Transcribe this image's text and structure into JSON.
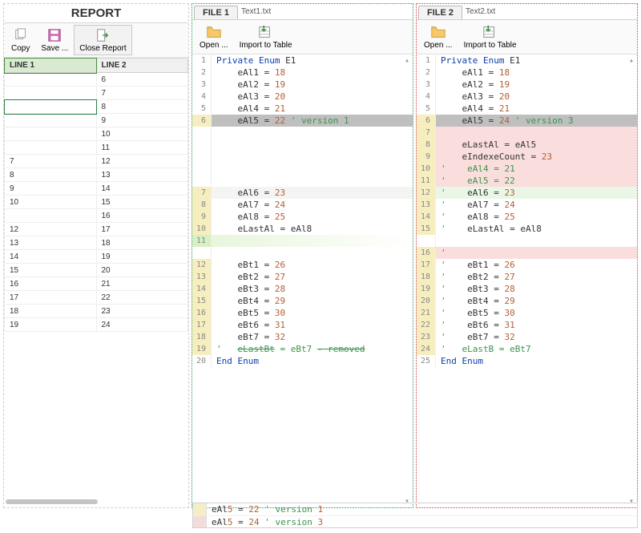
{
  "report": {
    "title": "REPORT",
    "toolbar": {
      "copy": "Copy",
      "save": "Save ...",
      "close": "Close Report"
    },
    "headers": {
      "col1": "LINE 1",
      "col2": "LINE 2"
    },
    "rows": [
      {
        "l1": "",
        "l2": "6"
      },
      {
        "l1": "",
        "l2": "7"
      },
      {
        "l1": "",
        "l2": "8"
      },
      {
        "l1": "",
        "l2": "9"
      },
      {
        "l1": "",
        "l2": "10"
      },
      {
        "l1": "",
        "l2": "11"
      },
      {
        "l1": "7",
        "l2": "12"
      },
      {
        "l1": "8",
        "l2": "13"
      },
      {
        "l1": "9",
        "l2": "14"
      },
      {
        "l1": "10",
        "l2": "15"
      },
      {
        "l1": "",
        "l2": "16"
      },
      {
        "l1": "12",
        "l2": "17"
      },
      {
        "l1": "13",
        "l2": "18"
      },
      {
        "l1": "14",
        "l2": "19"
      },
      {
        "l1": "15",
        "l2": "20"
      },
      {
        "l1": "16",
        "l2": "21"
      },
      {
        "l1": "17",
        "l2": "22"
      },
      {
        "l1": "18",
        "l2": "23"
      },
      {
        "l1": "19",
        "l2": "24"
      }
    ],
    "selected_row": 2
  },
  "file1": {
    "tab": "FILE 1",
    "name": "Text1.txt",
    "toolbar": {
      "open": "Open ...",
      "import": "Import to Table"
    },
    "lines": [
      {
        "n": 1,
        "gut": "",
        "cls": "",
        "html": "<span class=\"tok-kw\">Private Enum</span> E1"
      },
      {
        "n": 2,
        "gut": "",
        "cls": "",
        "html": "    eAl1 = <span class=\"tok-num\">18</span>"
      },
      {
        "n": 3,
        "gut": "",
        "cls": "",
        "html": "    eAl2 = <span class=\"tok-num\">19</span>"
      },
      {
        "n": 4,
        "gut": "",
        "cls": "",
        "html": "    eAl3 = <span class=\"tok-num\">20</span>"
      },
      {
        "n": 5,
        "gut": "",
        "cls": "",
        "html": "    eAl4 = <span class=\"tok-num\">21</span>"
      },
      {
        "n": 6,
        "gut": "mark-yellow",
        "cls": "line-diff-grey",
        "html": "    eAl5 = <span class=\"tok-num\">22</span> <span class=\"tok-cm\">' version 1</span>"
      },
      {
        "n": "",
        "gut": "",
        "cls": "",
        "html": ""
      },
      {
        "n": "",
        "gut": "",
        "cls": "",
        "html": ""
      },
      {
        "n": "",
        "gut": "",
        "cls": "",
        "html": ""
      },
      {
        "n": "",
        "gut": "",
        "cls": "",
        "html": ""
      },
      {
        "n": "",
        "gut": "",
        "cls": "",
        "html": ""
      },
      {
        "n": 7,
        "gut": "mark-yellow",
        "cls": "line-diff-greysoft",
        "html": "    eAl6 = <span class=\"tok-num\">23</span>"
      },
      {
        "n": 8,
        "gut": "mark-yellow",
        "cls": "",
        "html": "    eAl7 = <span class=\"tok-num\">24</span>"
      },
      {
        "n": 9,
        "gut": "mark-yellow",
        "cls": "",
        "html": "    eAl8 = <span class=\"tok-num\">25</span>"
      },
      {
        "n": 10,
        "gut": "mark-yellow",
        "cls": "",
        "html": "    eLastAl = eAl8"
      },
      {
        "n": 11,
        "gut": "mark-green",
        "cls": "line-diff-green-soft",
        "html": ""
      },
      {
        "n": "",
        "gut": "",
        "cls": "",
        "html": ""
      },
      {
        "n": 12,
        "gut": "mark-yellow",
        "cls": "",
        "html": "    eBt1 = <span class=\"tok-num\">26</span>"
      },
      {
        "n": 13,
        "gut": "mark-yellow",
        "cls": "",
        "html": "    eBt2 = <span class=\"tok-num\">27</span>"
      },
      {
        "n": 14,
        "gut": "mark-yellow",
        "cls": "",
        "html": "    eBt3 = <span class=\"tok-num\">28</span>"
      },
      {
        "n": 15,
        "gut": "mark-yellow",
        "cls": "",
        "html": "    eBt4 = <span class=\"tok-num\">29</span>"
      },
      {
        "n": 16,
        "gut": "mark-yellow",
        "cls": "",
        "html": "    eBt5 = <span class=\"tok-num\">30</span>"
      },
      {
        "n": 17,
        "gut": "mark-yellow",
        "cls": "",
        "html": "    eBt6 = <span class=\"tok-num\">31</span>"
      },
      {
        "n": 18,
        "gut": "mark-yellow",
        "cls": "",
        "html": "    eBt7 = <span class=\"tok-num\">32</span>"
      },
      {
        "n": 19,
        "gut": "mark-yellow",
        "cls": "",
        "html": "<span class=\"tok-cm\">'</span>   <span class=\"tok-cm-del\">eLastBt</span> <span class=\"tok-cm\">= eBt7</span> <span class=\"tok-cm-del\">- removed</span>"
      },
      {
        "n": 20,
        "gut": "",
        "cls": "",
        "html": "<span class=\"tok-kw\">End Enum</span>"
      }
    ]
  },
  "file2": {
    "tab": "FILE 2",
    "name": "Text2.txt",
    "toolbar": {
      "open": "Open ...",
      "import": "Import to Table"
    },
    "lines": [
      {
        "n": 1,
        "gut": "",
        "cls": "",
        "html": "<span class=\"tok-kw\">Private Enum</span> E1"
      },
      {
        "n": 2,
        "gut": "",
        "cls": "",
        "html": "    eAl1 = <span class=\"tok-num\">18</span>"
      },
      {
        "n": 3,
        "gut": "",
        "cls": "",
        "html": "    eAl2 = <span class=\"tok-num\">19</span>"
      },
      {
        "n": 4,
        "gut": "",
        "cls": "",
        "html": "    eAl3 = <span class=\"tok-num\">20</span>"
      },
      {
        "n": 5,
        "gut": "",
        "cls": "",
        "html": "    eAl4 = <span class=\"tok-num\">21</span>"
      },
      {
        "n": 6,
        "gut": "mark-yellow",
        "cls": "line-diff-grey",
        "html": "    eAl5 = <span class=\"tok-num\">24</span> <span class=\"tok-cm\">' version 3</span>"
      },
      {
        "n": 7,
        "gut": "mark-yellow",
        "cls": "line-diff-pink",
        "html": ""
      },
      {
        "n": 8,
        "gut": "mark-yellow",
        "cls": "line-diff-pink",
        "html": "    eLastAl = eAl5"
      },
      {
        "n": 9,
        "gut": "mark-yellow",
        "cls": "line-diff-pink",
        "html": "    eIndexeCount = <span class=\"tok-num\">23</span>"
      },
      {
        "n": 10,
        "gut": "mark-yellow",
        "cls": "line-diff-pink",
        "html": "<span class=\"tok-cm\">'    eAl4 = 21</span>"
      },
      {
        "n": 11,
        "gut": "mark-yellow",
        "cls": "line-diff-pink",
        "html": "<span class=\"tok-cm\">'    eAl5 = 22</span>"
      },
      {
        "n": 12,
        "gut": "mark-yellow",
        "cls": "line-diff-green2",
        "html": "<span class=\"tok-cm\">'</span>    eAl6 = <span class=\"tok-num\">23</span>"
      },
      {
        "n": 13,
        "gut": "mark-yellow",
        "cls": "",
        "html": "<span class=\"tok-cm\">'</span>    eAl7 = <span class=\"tok-num\">24</span>"
      },
      {
        "n": 14,
        "gut": "mark-yellow",
        "cls": "",
        "html": "<span class=\"tok-cm\">'</span>    eAl8 = <span class=\"tok-num\">25</span>"
      },
      {
        "n": 15,
        "gut": "mark-yellow",
        "cls": "",
        "html": "<span class=\"tok-cm\">'</span>    eLastAl = eAl8"
      },
      {
        "n": "",
        "gut": "",
        "cls": "",
        "html": ""
      },
      {
        "n": 16,
        "gut": "mark-yellow",
        "cls": "line-diff-pink",
        "html": "<span class=\"tok-cm\">'</span>"
      },
      {
        "n": 17,
        "gut": "mark-yellow",
        "cls": "",
        "html": "<span class=\"tok-cm\">'</span>    eBt1 = <span class=\"tok-num\">26</span>"
      },
      {
        "n": 18,
        "gut": "mark-yellow",
        "cls": "",
        "html": "<span class=\"tok-cm\">'</span>    eBt2 = <span class=\"tok-num\">27</span>"
      },
      {
        "n": 19,
        "gut": "mark-yellow",
        "cls": "",
        "html": "<span class=\"tok-cm\">'</span>    eBt3 = <span class=\"tok-num\">28</span>"
      },
      {
        "n": 20,
        "gut": "mark-yellow",
        "cls": "",
        "html": "<span class=\"tok-cm\">'</span>    eBt4 = <span class=\"tok-num\">29</span>"
      },
      {
        "n": 21,
        "gut": "mark-yellow",
        "cls": "",
        "html": "<span class=\"tok-cm\">'</span>    eBt5 = <span class=\"tok-num\">30</span>"
      },
      {
        "n": 22,
        "gut": "mark-yellow",
        "cls": "",
        "html": "<span class=\"tok-cm\">'</span>    eBt6 = <span class=\"tok-num\">31</span>"
      },
      {
        "n": 23,
        "gut": "mark-yellow",
        "cls": "",
        "html": "<span class=\"tok-cm\">'</span>    eBt7 = <span class=\"tok-num\">32</span>"
      },
      {
        "n": 24,
        "gut": "mark-yellow",
        "cls": "",
        "html": "<span class=\"tok-cm\">'</span>   <span class=\"tok-cm\">eLastB</span> <span class=\"tok-cm\">= eBt7</span>"
      },
      {
        "n": 25,
        "gut": "",
        "cls": "",
        "html": "<span class=\"tok-kw\">End Enum</span>"
      }
    ]
  },
  "summary": {
    "row1": "eAl5 = 22 ' version 1",
    "row2": "eAl5 = 24 ' version 3"
  }
}
